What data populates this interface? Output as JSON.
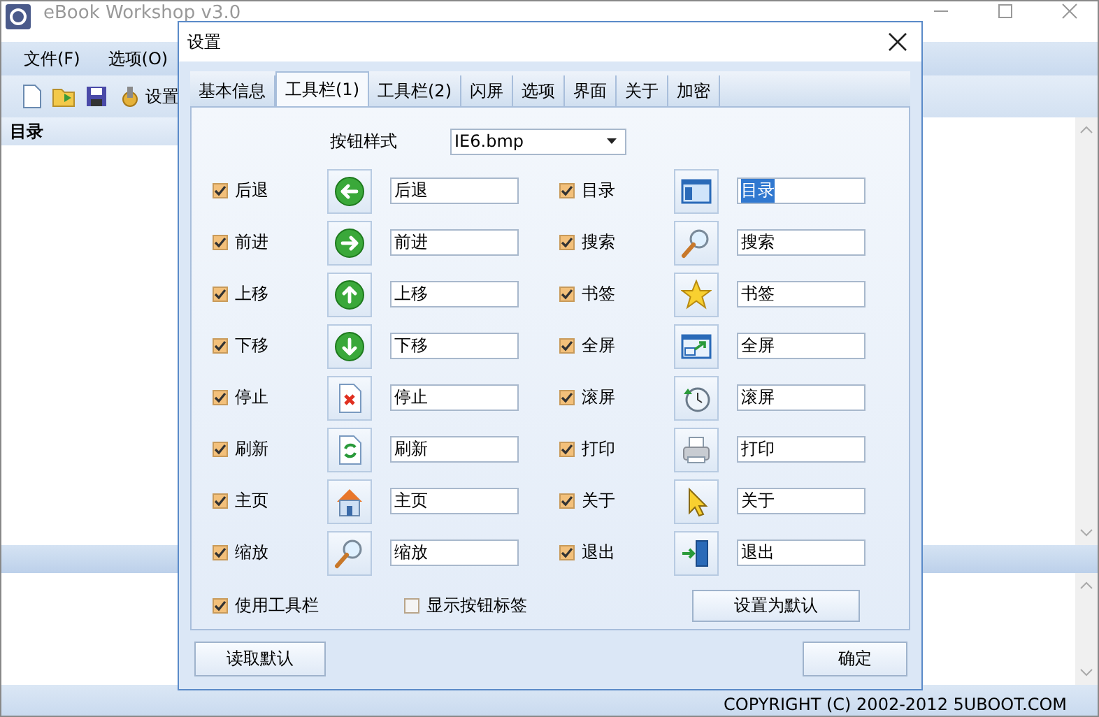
{
  "window": {
    "title": "eBook Workshop v3.0"
  },
  "menu": [
    {
      "label": "文件(F)"
    },
    {
      "label": "选项(O)"
    }
  ],
  "toolbar": {
    "settings_label": "设置"
  },
  "panel": {
    "title": "目录"
  },
  "status_bar": {
    "text": "COPYRIGHT (C) 2002-2012 5UBOOT.COM"
  },
  "dialog": {
    "title": "设置",
    "tabs": [
      {
        "label": "基本信息",
        "selected": false
      },
      {
        "label": "工具栏(1)",
        "selected": true
      },
      {
        "label": "工具栏(2)",
        "selected": false
      },
      {
        "label": "闪屏",
        "selected": false
      },
      {
        "label": "选项",
        "selected": false
      },
      {
        "label": "界面",
        "selected": false
      },
      {
        "label": "关于",
        "selected": false
      },
      {
        "label": "加密",
        "selected": false
      }
    ],
    "style_label": "按钮样式",
    "style_value": "IE6.bmp",
    "buttons_left": [
      {
        "label": "后退",
        "checked": true,
        "caption": "后退",
        "text_selected": false
      },
      {
        "label": "前进",
        "checked": true,
        "caption": "前进",
        "text_selected": false
      },
      {
        "label": "上移",
        "checked": true,
        "caption": "上移",
        "text_selected": false
      },
      {
        "label": "下移",
        "checked": true,
        "caption": "下移",
        "text_selected": false
      },
      {
        "label": "停止",
        "checked": true,
        "caption": "停止",
        "text_selected": false
      },
      {
        "label": "刷新",
        "checked": true,
        "caption": "刷新",
        "text_selected": false
      },
      {
        "label": "主页",
        "checked": true,
        "caption": "主页",
        "text_selected": false
      },
      {
        "label": "缩放",
        "checked": true,
        "caption": "缩放",
        "text_selected": false
      }
    ],
    "buttons_right": [
      {
        "label": "目录",
        "checked": true,
        "caption": "目录",
        "text_selected": true
      },
      {
        "label": "搜索",
        "checked": true,
        "caption": "搜索",
        "text_selected": false
      },
      {
        "label": "书签",
        "checked": true,
        "caption": "书签",
        "text_selected": false
      },
      {
        "label": "全屏",
        "checked": true,
        "caption": "全屏",
        "text_selected": false
      },
      {
        "label": "滚屏",
        "checked": true,
        "caption": "滚屏",
        "text_selected": false
      },
      {
        "label": "打印",
        "checked": true,
        "caption": "打印",
        "text_selected": false
      },
      {
        "label": "关于",
        "checked": true,
        "caption": "关于",
        "text_selected": false
      },
      {
        "label": "退出",
        "checked": true,
        "caption": "退出",
        "text_selected": false
      }
    ],
    "options": [
      {
        "label": "使用工具栏",
        "checked": true
      },
      {
        "label": "显示按钮标签",
        "checked": false
      }
    ],
    "set_default_button": "设置为默认",
    "load_default_button": "读取默认",
    "ok_button": "确定"
  }
}
